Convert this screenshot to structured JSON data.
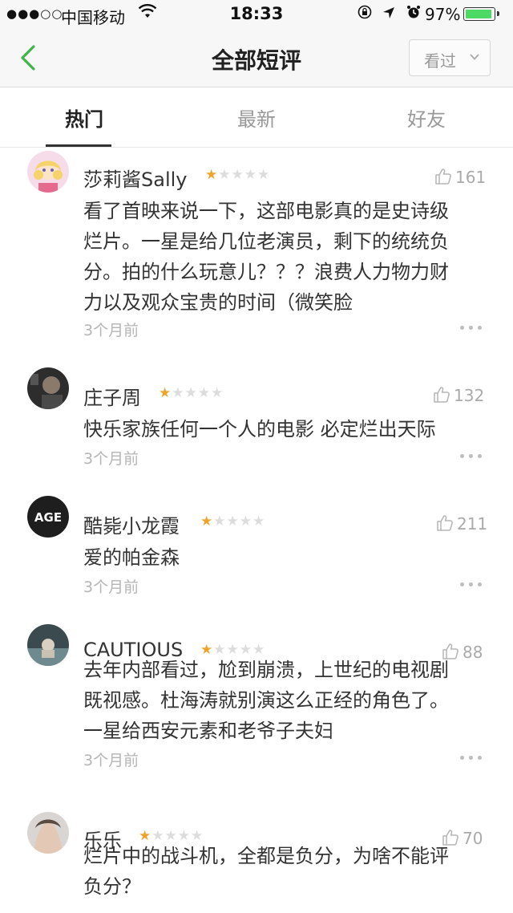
{
  "status_bar": {
    "signal": "●●●○○",
    "carrier": "中国移动",
    "time": "18:33",
    "battery_pct": "97%",
    "battery_level": 0.97,
    "icons": [
      "wifi-icon",
      "rotation-lock-icon",
      "location-icon",
      "alarm-icon",
      "battery-icon"
    ]
  },
  "nav": {
    "back_icon": "chevron-left-icon",
    "title": "全部短评",
    "filter_label": "看过",
    "filter_icon": "chevron-down-icon",
    "accent_color": "#42b549"
  },
  "tabs": [
    {
      "label": "热门",
      "active": true
    },
    {
      "label": "最新",
      "active": false
    },
    {
      "label": "好友",
      "active": false
    }
  ],
  "comments": [
    {
      "user": "莎莉酱Sally",
      "rating": 1,
      "likes": "161",
      "text_lines": [
        "看了首映来说一下，这部电影真的是史诗级",
        "烂片。一星是给几位老演员，剩下的统统负",
        "分。拍的什么玩意儿？？？浪费人力物力财",
        "力以及观众宝贵的时间（微笑脸"
      ],
      "time": "3个月前"
    },
    {
      "user": "庄子周",
      "rating": 1,
      "likes": "132",
      "text_lines": [
        "快乐家族任何一个人的电影 必定烂出天际"
      ],
      "time": "3个月前"
    },
    {
      "user": "酷毙小龙霞",
      "rating": 1,
      "likes": "211",
      "text_lines": [
        "爱的帕金森"
      ],
      "time": "3个月前",
      "avatar_text": "AGE"
    },
    {
      "user": "CAUTIOUS",
      "rating": 1,
      "likes": "88",
      "text_lines": [
        "去年内部看过，尬到崩溃，上世纪的电视剧",
        "既视感。杜海涛就别演这么正经的角色了。",
        "一星给西安元素和老爷子夫妇"
      ],
      "time": "3个月前"
    },
    {
      "user": "乐乐",
      "rating": 1,
      "likes": "70",
      "text_lines": [
        "烂片中的战斗机，全都是负分，为啥不能评",
        "负分？"
      ],
      "time": ""
    }
  ]
}
